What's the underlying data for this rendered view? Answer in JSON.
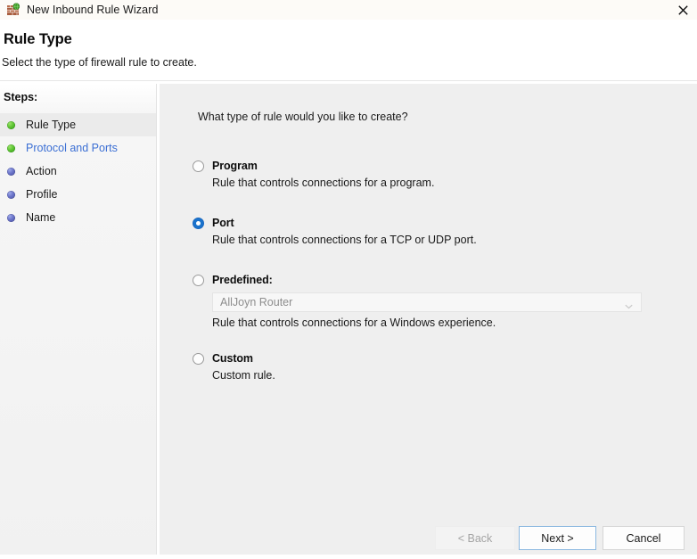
{
  "window": {
    "title": "New Inbound Rule Wizard",
    "icon": "firewall-globe-icon",
    "close_label": "✕"
  },
  "header": {
    "title": "Rule Type",
    "subtitle": "Select the type of firewall rule to create."
  },
  "sidebar": {
    "heading": "Steps:",
    "items": [
      {
        "label": "Rule Type",
        "bullet_color": "#53bd2b",
        "state": "current",
        "is_link": false
      },
      {
        "label": "Protocol and Ports",
        "bullet_color": "#53bd2b",
        "state": "link",
        "is_link": true
      },
      {
        "label": "Action",
        "bullet_color": "#5f68b8",
        "state": "pending",
        "is_link": false
      },
      {
        "label": "Profile",
        "bullet_color": "#5f68b8",
        "state": "pending",
        "is_link": false
      },
      {
        "label": "Name",
        "bullet_color": "#5f68b8",
        "state": "pending",
        "is_link": false
      }
    ]
  },
  "main": {
    "question": "What type of rule would you like to create?",
    "options": [
      {
        "id": "program",
        "title": "Program",
        "description": "Rule that controls connections for a program.",
        "selected": false
      },
      {
        "id": "port",
        "title": "Port",
        "description": "Rule that controls connections for a TCP or UDP port.",
        "selected": true
      },
      {
        "id": "predefined",
        "title": "Predefined:",
        "description": "Rule that controls connections for a Windows experience.",
        "selected": false,
        "combo": {
          "value": "AllJoyn Router",
          "enabled": false,
          "arrow_icon": "chevron-down-icon"
        }
      },
      {
        "id": "custom",
        "title": "Custom",
        "description": "Custom rule.",
        "selected": false
      }
    ]
  },
  "footer": {
    "back_label": "< Back",
    "back_enabled": false,
    "next_label": "Next >",
    "next_focused": true,
    "cancel_label": "Cancel"
  },
  "colors": {
    "accent": "#1a73cc",
    "link": "#3b6fd4",
    "focus_border": "#8bb8e0",
    "content_bg": "#efefef",
    "sidebar_bg": "#f1f1f1",
    "step_green": "#53bd2b",
    "step_blue": "#5f68b8"
  }
}
